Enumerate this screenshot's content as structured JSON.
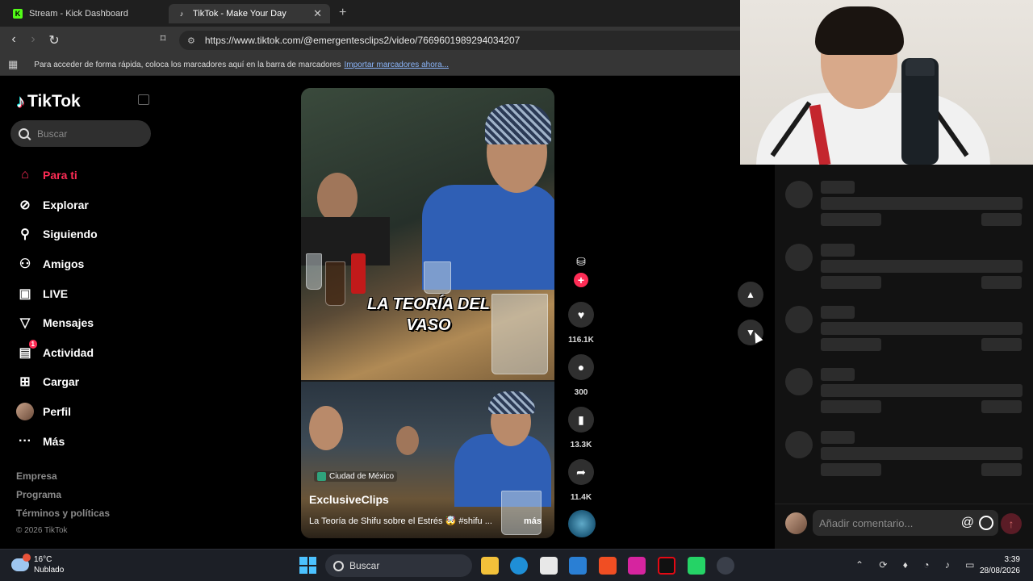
{
  "browser": {
    "tabs": [
      {
        "title": "Stream - Kick Dashboard",
        "favicon": "kick-icon",
        "active": false
      },
      {
        "title": "TikTok - Make Your Day",
        "favicon": "tiktok-icon",
        "active": true
      }
    ],
    "url": "https://www.tiktok.com/@emergentesclips2/video/7669601989294034207",
    "bookmarks_prompt": "Para acceder de forma rápida, coloca los marcadores aquí en la barra de marcadores",
    "bookmarks_link": "Importar marcadores ahora..."
  },
  "tiktok": {
    "logo": "TikTok",
    "search_placeholder": "Buscar",
    "nav": [
      {
        "label": "Para ti",
        "icon": "home-icon",
        "active": true
      },
      {
        "label": "Explorar",
        "icon": "compass-icon"
      },
      {
        "label": "Siguiendo",
        "icon": "following-icon"
      },
      {
        "label": "Amigos",
        "icon": "friends-icon"
      },
      {
        "label": "LIVE",
        "icon": "live-icon"
      },
      {
        "label": "Mensajes",
        "icon": "messages-icon"
      },
      {
        "label": "Actividad",
        "icon": "activity-icon",
        "badge": "1"
      },
      {
        "label": "Cargar",
        "icon": "upload-icon"
      },
      {
        "label": "Perfil",
        "icon": "profile-avatar"
      },
      {
        "label": "Más",
        "icon": "more-icon"
      }
    ],
    "footer": {
      "company": "Empresa",
      "program": "Programa",
      "terms": "Términos y políticas",
      "copyright": "© 2026 TikTok"
    },
    "video": {
      "overlay_title": "LA TEORÍA DEL VASO",
      "location": "Ciudad de México",
      "author": "ExclusiveClips",
      "caption": "La Teoría de Shifu sobre el Estrés 🤯 #shifu ...",
      "more": "más"
    },
    "actions": {
      "likes": "116.1K",
      "comments": "300",
      "saves": "13.3K",
      "shares": "11.4K"
    }
  },
  "comments_panel": {
    "input_placeholder": "Añadir comentario...",
    "at_symbol": "@"
  },
  "taskbar": {
    "temperature": "16°C",
    "weather": "Nublado",
    "search": "Buscar",
    "time": "3:39",
    "date": "28/08/2026"
  },
  "colors": {
    "accent": "#fe2c55",
    "background": "#000000",
    "panel": "#121212"
  }
}
